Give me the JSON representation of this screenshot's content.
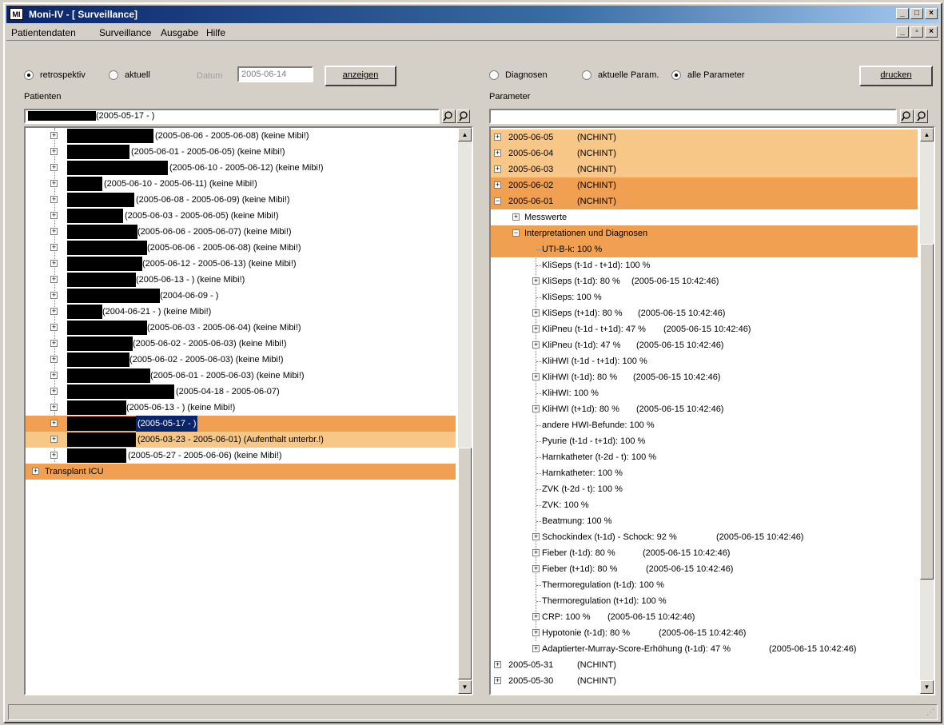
{
  "window": {
    "title": "Moni-IV - [ Surveillance]",
    "app_icon": "MI"
  },
  "menu": [
    "Patientendaten",
    "Surveillance",
    "Ausgabe",
    "Hilfe"
  ],
  "left": {
    "mode_retro": "retrospektiv",
    "mode_current": "aktuell",
    "date_label": "Datum",
    "date_value": "2005-06-14",
    "show_button": "anzeigen",
    "patients_label": "Patienten",
    "filter_value": "(2005-05-17 - )",
    "patients": [
      "(2005-06-06 - 2005-06-08) (keine Mibi!)",
      "(2005-06-01 - 2005-06-05) (keine Mibi!)",
      "(2005-06-10 - 2005-06-12) (keine Mibi!)",
      "(2005-06-10 - 2005-06-11) (keine Mibi!)",
      "(2005-06-08 - 2005-06-09) (keine Mibi!)",
      "(2005-06-03 - 2005-06-05) (keine Mibi!)",
      "(2005-06-06 - 2005-06-07) (keine Mibi!)",
      "(2005-06-06 - 2005-06-08) (keine Mibi!)",
      "(2005-06-12 - 2005-06-13) (keine Mibi!)",
      "(2005-06-13 - ) (keine Mibi!)",
      "(2004-06-09 - )",
      "(2004-06-21 - ) (keine Mibi!)",
      "(2005-06-03 - 2005-06-04) (keine Mibi!)",
      "(2005-06-02 - 2005-06-03) (keine Mibi!)",
      "(2005-06-02 - 2005-06-03) (keine Mibi!)",
      "(2005-06-01 - 2005-06-03) (keine Mibi!)",
      "(2005-04-18 - 2005-06-07)",
      "(2005-06-13 - ) (keine Mibi!)",
      "(2005-05-17 - )",
      "(2005-03-23 - 2005-06-01) (Aufenthalt unterbr.!)",
      "(2005-05-27 - 2005-06-06) (keine Mibi!)"
    ],
    "ward": "Transplant ICU"
  },
  "right": {
    "mode_diag": "Diagnosen",
    "mode_current_params": "aktuelle Param.",
    "mode_all_params": "alle Parameter",
    "print_button": "drucken",
    "params_label": "Parameter",
    "days": [
      {
        "date": "2005-06-05",
        "tag": "(NCHINT)"
      },
      {
        "date": "2005-06-04",
        "tag": "(NCHINT)"
      },
      {
        "date": "2005-06-03",
        "tag": "(NCHINT)"
      },
      {
        "date": "2005-06-02",
        "tag": "(NCHINT)"
      },
      {
        "date": "2005-06-01",
        "tag": "(NCHINT)"
      }
    ],
    "messwerte": "Messwerte",
    "interp": "Interpretationen und Diagnosen",
    "items": [
      {
        "text": "UTI-B-k: 100 %",
        "ts": ""
      },
      {
        "text": "KliSeps (t-1d - t+1d): 100 %",
        "ts": ""
      },
      {
        "text": "KliSeps (t-1d):  80 %",
        "ts": "(2005-06-15 10:42:46)"
      },
      {
        "text": "KliSeps: 100 %",
        "ts": ""
      },
      {
        "text": "KliSeps (t+1d):  80 %",
        "ts": "(2005-06-15 10:42:46)"
      },
      {
        "text": "KliPneu (t-1d - t+1d):  47 %",
        "ts": "(2005-06-15 10:42:46)"
      },
      {
        "text": "KliPneu (t-1d):  47 %",
        "ts": "(2005-06-15 10:42:46)"
      },
      {
        "text": "KliHWI (t-1d - t+1d): 100 %",
        "ts": ""
      },
      {
        "text": "KliHWI (t-1d):  80 %",
        "ts": "(2005-06-15 10:42:46)"
      },
      {
        "text": "KliHWI: 100 %",
        "ts": ""
      },
      {
        "text": "KliHWI (t+1d):  80 %",
        "ts": "(2005-06-15 10:42:46)"
      },
      {
        "text": "andere HWI-Befunde: 100 %",
        "ts": ""
      },
      {
        "text": "Pyurie (t-1d - t+1d): 100 %",
        "ts": ""
      },
      {
        "text": "Harnkatheter (t-2d - t): 100 %",
        "ts": ""
      },
      {
        "text": "Harnkatheter: 100 %",
        "ts": ""
      },
      {
        "text": "ZVK (t-2d - t): 100 %",
        "ts": ""
      },
      {
        "text": "ZVK: 100 %",
        "ts": ""
      },
      {
        "text": "Beatmung: 100 %",
        "ts": ""
      },
      {
        "text": "Schockindex (t-1d) - Schock:  92 %",
        "ts": "(2005-06-15 10:42:46)"
      },
      {
        "text": "Fieber (t-1d):  80 %",
        "ts": "(2005-06-15 10:42:46)"
      },
      {
        "text": "Fieber (t+1d):  80 %",
        "ts": "(2005-06-15 10:42:46)"
      },
      {
        "text": "Thermoregulation (t-1d): 100 %",
        "ts": ""
      },
      {
        "text": "Thermoregulation (t+1d): 100 %",
        "ts": ""
      },
      {
        "text": "CRP: 100 %",
        "ts": "(2005-06-15 10:42:46)"
      },
      {
        "text": "Hypotonie (t-1d):  80 %",
        "ts": "(2005-06-15 10:42:46)"
      },
      {
        "text": "Adaptierter-Murray-Score-Erhöhung (t-1d):  47 %",
        "ts": "(2005-06-15 10:42:46)"
      }
    ],
    "later_days": [
      {
        "date": "2005-05-31",
        "tag": "(NCHINT)"
      },
      {
        "date": "2005-05-30",
        "tag": "(NCHINT)"
      }
    ]
  },
  "colors": {
    "dark_highlight": "#f0a050",
    "light_highlight": "#f7c788",
    "selection": "#0a246a"
  }
}
